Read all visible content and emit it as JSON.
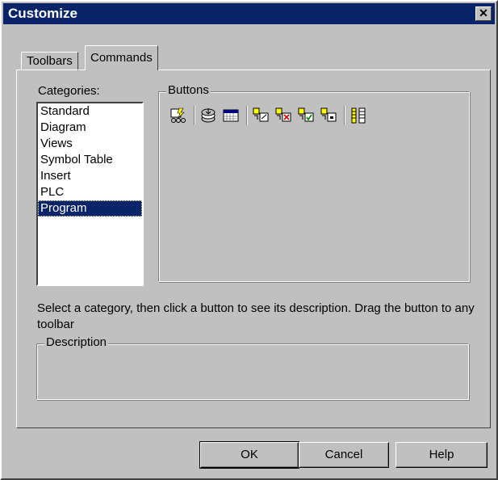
{
  "window": {
    "title": "Customize",
    "close_glyph": "✕"
  },
  "tabs": [
    {
      "label": "Toolbars"
    },
    {
      "label": "Commands"
    }
  ],
  "categories": {
    "label": "Categories:",
    "items": [
      "Standard",
      "Diagram",
      "Views",
      "Symbol Table",
      "Insert",
      "PLC",
      "Program"
    ],
    "selected": "Program"
  },
  "buttons_group": {
    "label": "Buttons",
    "icons": [
      "run-program-icon",
      "load-stack-icon",
      "timing-grid-icon",
      "edit-element-icon",
      "delete-element-icon",
      "check-element-icon",
      "insert-element-icon",
      "columns-icon"
    ]
  },
  "instruction": "Select a category, then click a button to see its description. Drag the button to any toolbar",
  "description_group": {
    "label": "Description",
    "text": ""
  },
  "footer": {
    "ok_label": "OK",
    "cancel_label": "Cancel",
    "help_label": "Help"
  },
  "colors": {
    "titlebar": "#0a246a",
    "face": "#c0c0c0",
    "selection": "#0a246a"
  }
}
